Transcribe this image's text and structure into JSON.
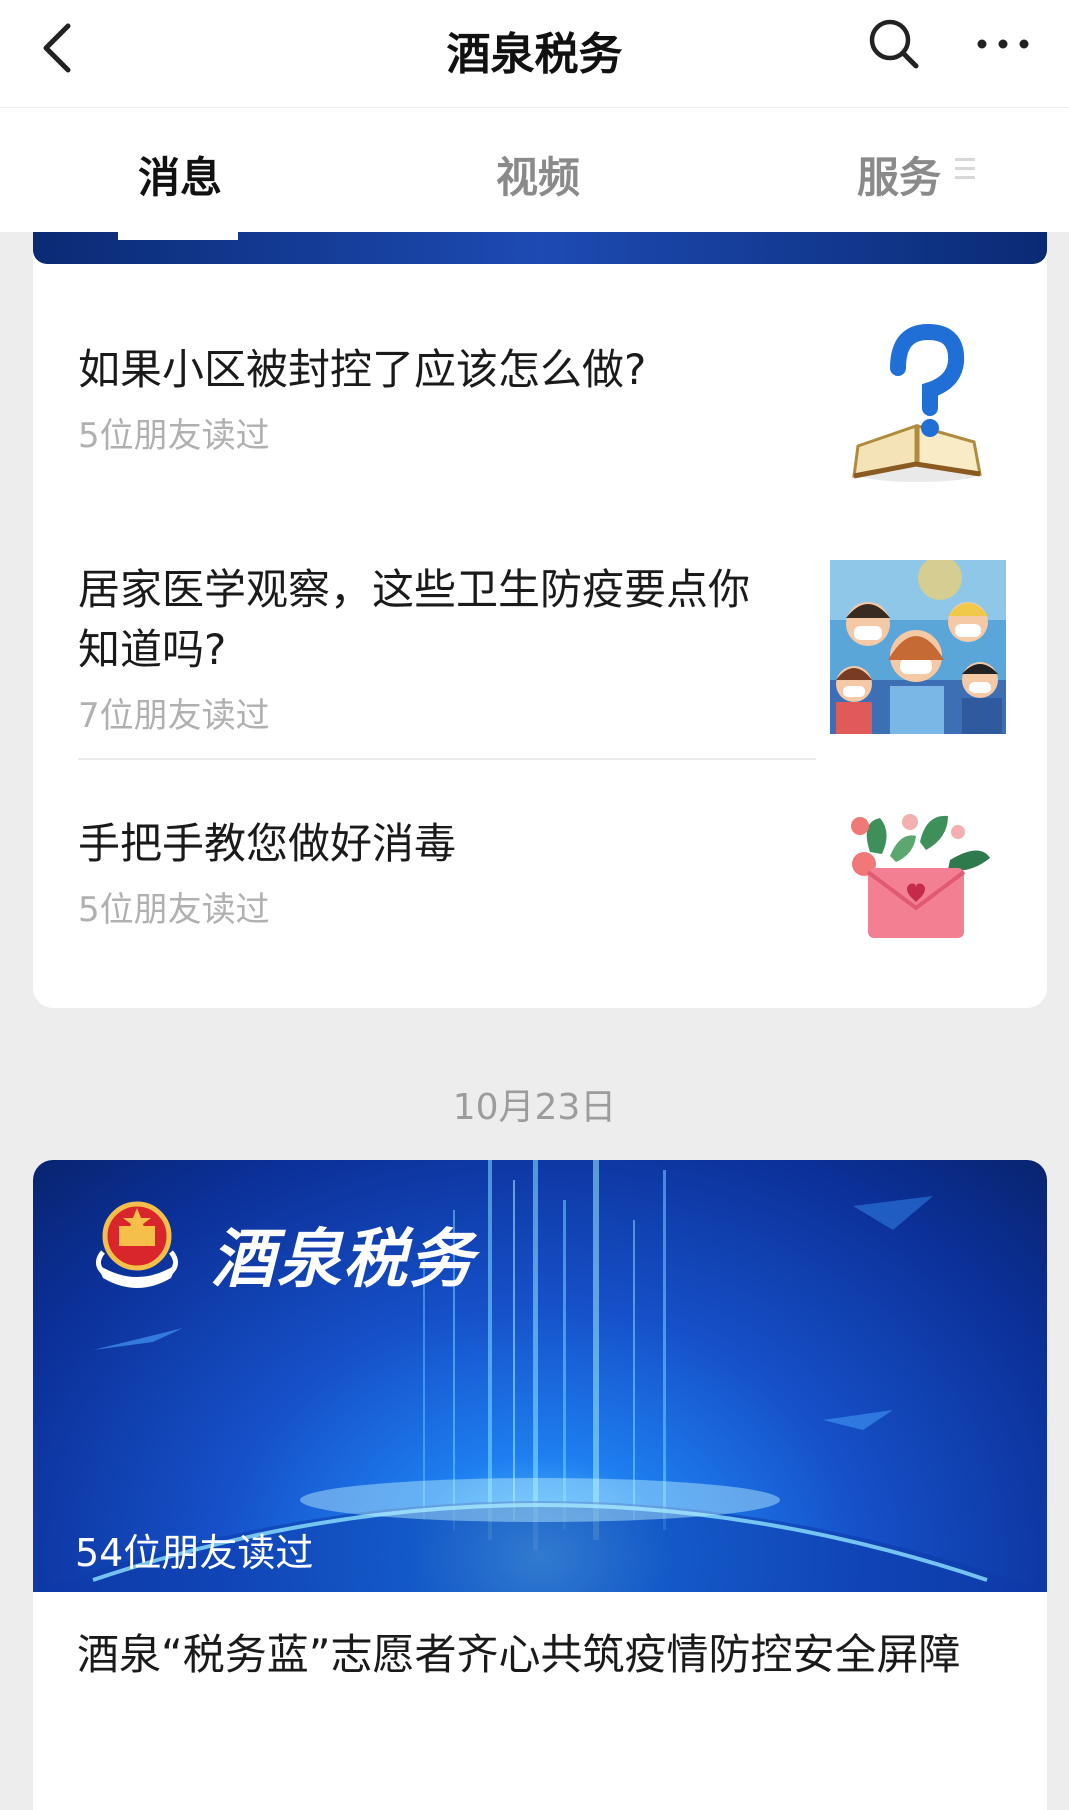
{
  "header": {
    "title": "酒泉税务",
    "back_icon": "chevron-left-icon",
    "search_icon": "search-icon",
    "more_icon": "more-dots-icon"
  },
  "tabs": [
    {
      "label": "消息",
      "active": true
    },
    {
      "label": "视频",
      "active": false
    },
    {
      "label": "服务",
      "active": false
    }
  ],
  "article_group_1": {
    "items": [
      {
        "title": "如果小区被封控了应该怎么做?",
        "meta": "5位朋友读过",
        "thumb_icon": "question-book-icon"
      },
      {
        "title": "居家医学观察，这些卫生防疫要点你知道吗?",
        "meta": "7位朋友读过",
        "thumb_icon": "masked-people-illustration"
      },
      {
        "title": "手把手教您做好消毒",
        "meta": "5位朋友读过",
        "thumb_icon": "flower-envelope-icon"
      }
    ]
  },
  "date_separator": "10月23日",
  "article_group_2": {
    "banner_brand": "酒泉税务",
    "banner_readers": "54位朋友读过",
    "title": "酒泉“税务蓝”志愿者齐心共筑疫情防控安全屏障",
    "emblem_icon": "tax-emblem-icon"
  },
  "colors": {
    "accent_blue": "#1650c8",
    "meta_gray": "#b0b0b0",
    "background": "#ededed"
  }
}
